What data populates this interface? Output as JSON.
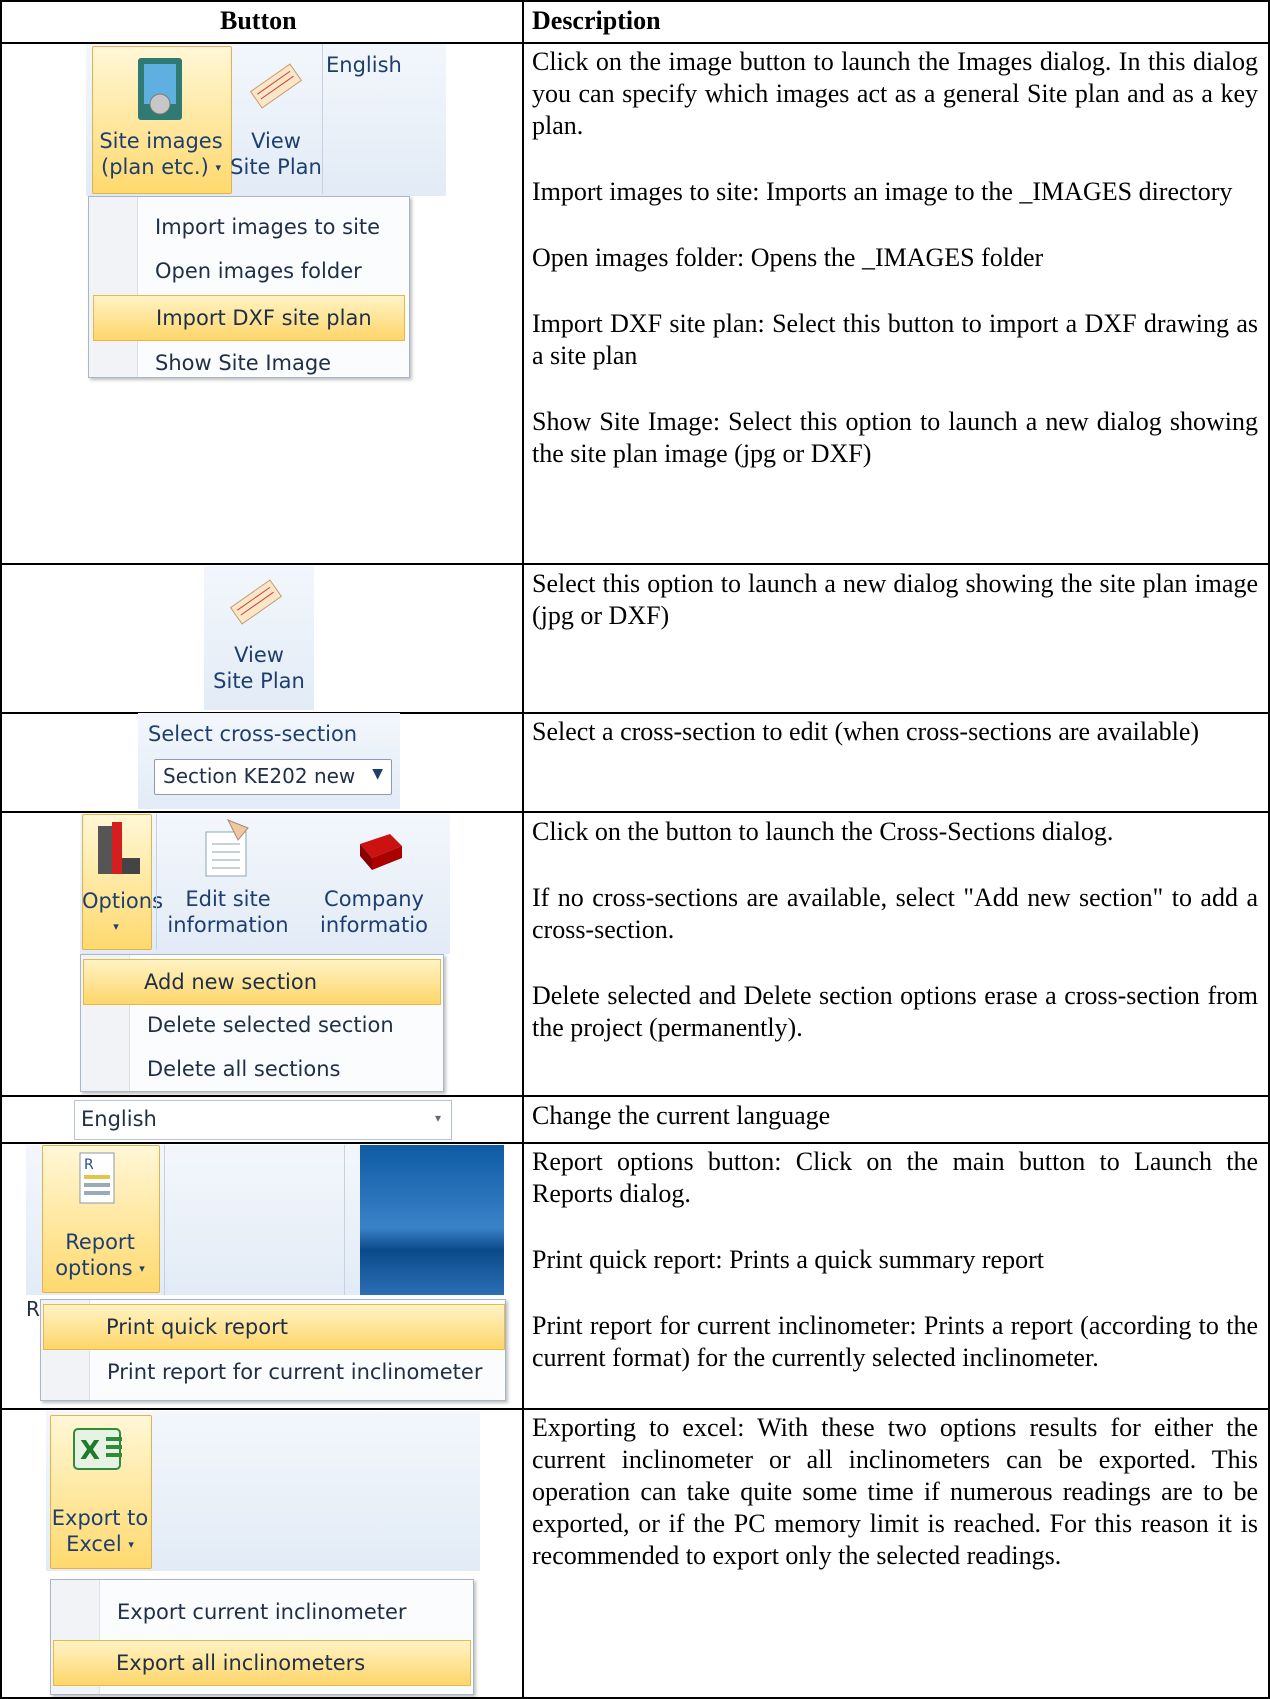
{
  "table": {
    "header": {
      "button": "Button",
      "description": "Description"
    }
  },
  "rows": [
    {
      "button": {
        "site_images_label": [
          "Site images",
          "(plan etc.)"
        ],
        "view_site_plan_label": [
          "View",
          "Site Plan"
        ],
        "language": "English",
        "menu": [
          "Import images to site",
          "Open images folder",
          "Import DXF site plan",
          "Show Site Image"
        ],
        "highlighted_item": "Import DXF site plan"
      },
      "description": [
        "Click on the image button to launch the Images dialog. In this dialog you can specify which images act as a general Site plan and as a key plan.",
        "Import images to site: Imports an image to the _IMAGES directory",
        "Open images folder: Opens the _IMAGES folder",
        "Import DXF site plan: Select this button to import a DXF drawing as a site plan",
        "Show Site Image: Select this option to launch a new dialog showing the site plan image (jpg or DXF)"
      ]
    },
    {
      "button": {
        "view_site_plan_label": [
          "View",
          "Site Plan"
        ]
      },
      "description": [
        "Select this option to launch a new dialog showing the site plan image (jpg or DXF)"
      ]
    },
    {
      "button": {
        "caption": "Select cross-section",
        "selected": "Section KE202 new"
      },
      "description": [
        "Select a cross-section to edit (when cross-sections are available)"
      ]
    },
    {
      "button": {
        "options_label": "Options",
        "edit_site_label": [
          "Edit site",
          "information"
        ],
        "company_label": [
          "Company",
          "informatio"
        ],
        "menu": [
          "Add new section",
          "Delete selected section",
          "Delete all sections"
        ],
        "highlighted_item": "Add new section"
      },
      "description": [
        "Click on the button to launch the Cross-Sections dialog.",
        "If no cross-sections are available, select \"Add new section\" to add a cross-section.",
        "Delete selected and Delete section options erase a cross-section from the project (permanently)."
      ]
    },
    {
      "button": {
        "language": "English"
      },
      "description": [
        "Change the current language"
      ]
    },
    {
      "button": {
        "report_label": [
          "Report",
          "options"
        ],
        "cut_text": "Re",
        "menu": [
          "Print quick report",
          "Print report for current inclinometer"
        ],
        "highlighted_item": "Print quick report"
      },
      "description": [
        "Report options button: Click on the main button to Launch the Reports dialog.",
        "Print quick report: Prints a quick summary report",
        "Print report for current inclinometer: Prints a report (according to the current format) for the currently selected inclinometer."
      ]
    },
    {
      "button": {
        "export_label": [
          "Export to",
          "Excel"
        ],
        "menu": [
          "Export current inclinometer",
          "Export all inclinometers"
        ],
        "highlighted_item": "Export all inclinometers"
      },
      "description": [
        "Exporting to excel: With these two options results for either the current inclinometer or all inclinometers can be exported. This operation can take quite some time if numerous readings are to be exported, or if the PC memory limit is reached. For this reason it is recommended to export only the selected readings."
      ]
    }
  ],
  "colors": {
    "highlight": "#ffd96e",
    "ribbon": "#e2ebf6",
    "label_text": "#1e3f6e"
  },
  "icons": [
    "site-images-icon",
    "site-plan-icon",
    "options-icon",
    "edit-site-icon",
    "company-icon",
    "report-icon",
    "excel-icon"
  ]
}
